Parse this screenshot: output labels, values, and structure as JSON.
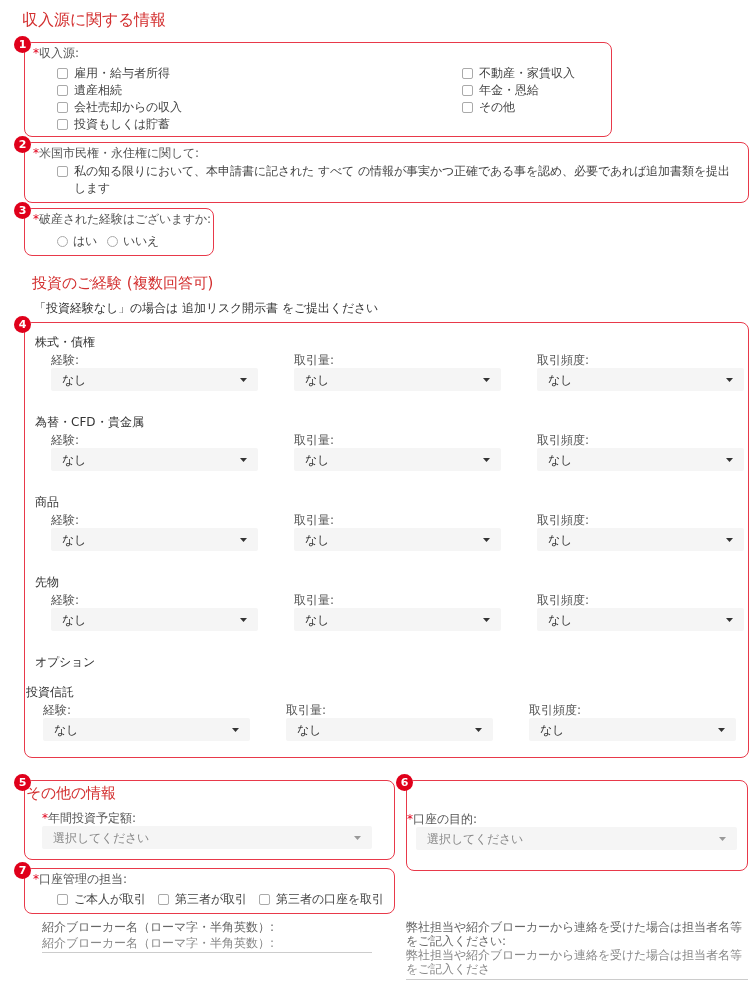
{
  "income_section": {
    "title": "収入源に関する情報",
    "income_sources": {
      "badge": "1",
      "mark": "*",
      "label": "収入源:",
      "columns": [
        [
          {
            "label": "雇用・給与者所得",
            "checked": false
          },
          {
            "label": "遺産相続",
            "checked": false
          },
          {
            "label": "会社売却からの収入",
            "checked": false
          },
          {
            "label": "投資もしくは貯蓄",
            "checked": false
          }
        ],
        [
          {
            "label": "不動産・家賃収入",
            "checked": false
          },
          {
            "label": "年金・恩給",
            "checked": false
          },
          {
            "label": "その他",
            "checked": false
          }
        ]
      ]
    },
    "citizenship": {
      "badge": "2",
      "mark": "*",
      "label": "米国市民権・永住権に関して:",
      "option": {
        "label": "私の知る限りにおいて、本申請書に記された すべて の情報が事実かつ正確である事を認め、必要であれば追加書類を提出します",
        "checked": false
      }
    },
    "bankruptcy": {
      "badge": "3",
      "mark": "*",
      "label": "破産された経験はございますか:",
      "options": [
        {
          "label": "はい",
          "selected": false
        },
        {
          "label": "いいえ",
          "selected": false
        }
      ]
    }
  },
  "experience_section": {
    "title": "投資のご経験 (複数回答可)",
    "note": "「投資経験なし」の場合は 追加リスク開示書 をご提出ください",
    "badge": "4",
    "categories": [
      {
        "kind": "selects",
        "title": "株式・債権",
        "fields": [
          {
            "label": "経験:",
            "value": "なし"
          },
          {
            "label": "取引量:",
            "value": "なし"
          },
          {
            "label": "取引頻度:",
            "value": "なし"
          }
        ]
      },
      {
        "kind": "selects",
        "title": "為替・CFD・貴金属",
        "fields": [
          {
            "label": "経験:",
            "value": "なし"
          },
          {
            "label": "取引量:",
            "value": "なし"
          },
          {
            "label": "取引頻度:",
            "value": "なし"
          }
        ]
      },
      {
        "kind": "selects",
        "title": "商品",
        "fields": [
          {
            "label": "経験:",
            "value": "なし"
          },
          {
            "label": "取引量:",
            "value": "なし"
          },
          {
            "label": "取引頻度:",
            "value": "なし"
          }
        ]
      },
      {
        "kind": "selects",
        "title": "先物",
        "fields": [
          {
            "label": "経験:",
            "value": "なし"
          },
          {
            "label": "取引量:",
            "value": "なし"
          },
          {
            "label": "取引頻度:",
            "value": "なし"
          }
        ]
      },
      {
        "kind": "heading",
        "title": "オプション"
      },
      {
        "kind": "selects_shifted",
        "title": "投資信託",
        "fields": [
          {
            "label": "経験:",
            "value": "なし"
          },
          {
            "label": "取引量:",
            "value": "なし"
          },
          {
            "label": "取引頻度:",
            "value": "なし"
          }
        ]
      }
    ]
  },
  "other_section": {
    "title": "その他の情報",
    "badge": "5",
    "annual_investment": {
      "mark": "*",
      "label": "年間投資予定額:",
      "placeholder": "選択してください"
    },
    "account_purpose": {
      "badge": "6",
      "mark": "*",
      "label": "口座の目的:",
      "placeholder": "選択してください"
    },
    "account_management": {
      "badge": "7",
      "mark": "*",
      "label": "口座管理の担当:",
      "options": [
        {
          "label": "ご本人が取引",
          "checked": false
        },
        {
          "label": "第三者が取引",
          "checked": false
        },
        {
          "label": "第三者の口座を取引",
          "checked": false
        }
      ]
    },
    "broker_name": {
      "label": "紹介ブローカー名（ローマ字・半角英数）:",
      "placeholder": "紹介ブローカー名（ローマ字・半角英数）:"
    },
    "contact_name": {
      "label": "弊社担当や紹介ブローカーから連絡を受けた場合は担当者名等をご記入ください:",
      "placeholder": "弊社担当や紹介ブローカーから連絡を受けた場合は担当者名等をご記入くださ"
    }
  }
}
